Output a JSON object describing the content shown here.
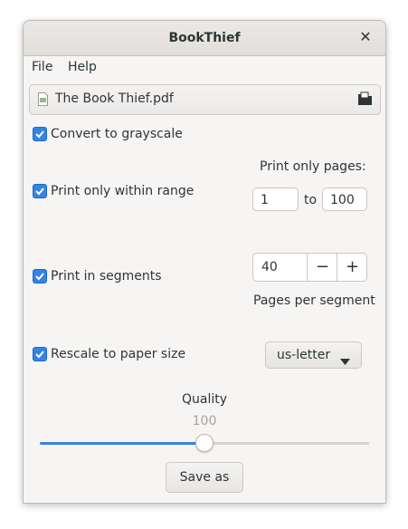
{
  "window": {
    "title": "BookThief"
  },
  "menu": {
    "file": "File",
    "help": "Help"
  },
  "file": {
    "name": "The Book Thief.pdf"
  },
  "options": {
    "grayscale": {
      "label": "Convert to grayscale",
      "checked": true
    },
    "range": {
      "label": "Print only within range",
      "checked": true,
      "heading": "Print only pages:",
      "from": "1",
      "to_label": "to",
      "to": "100"
    },
    "segments": {
      "label": "Print in segments",
      "checked": true,
      "value": "40",
      "minus": "−",
      "plus": "+",
      "caption": "Pages per segment"
    },
    "rescale": {
      "label": "Rescale to paper size",
      "checked": true,
      "paper": "us-letter"
    }
  },
  "quality": {
    "label": "Quality",
    "value": "100",
    "fraction": 0.5
  },
  "actions": {
    "save_as": "Save as"
  },
  "colors": {
    "accent": "#3584e4",
    "window_bg": "#f6f5f4"
  }
}
